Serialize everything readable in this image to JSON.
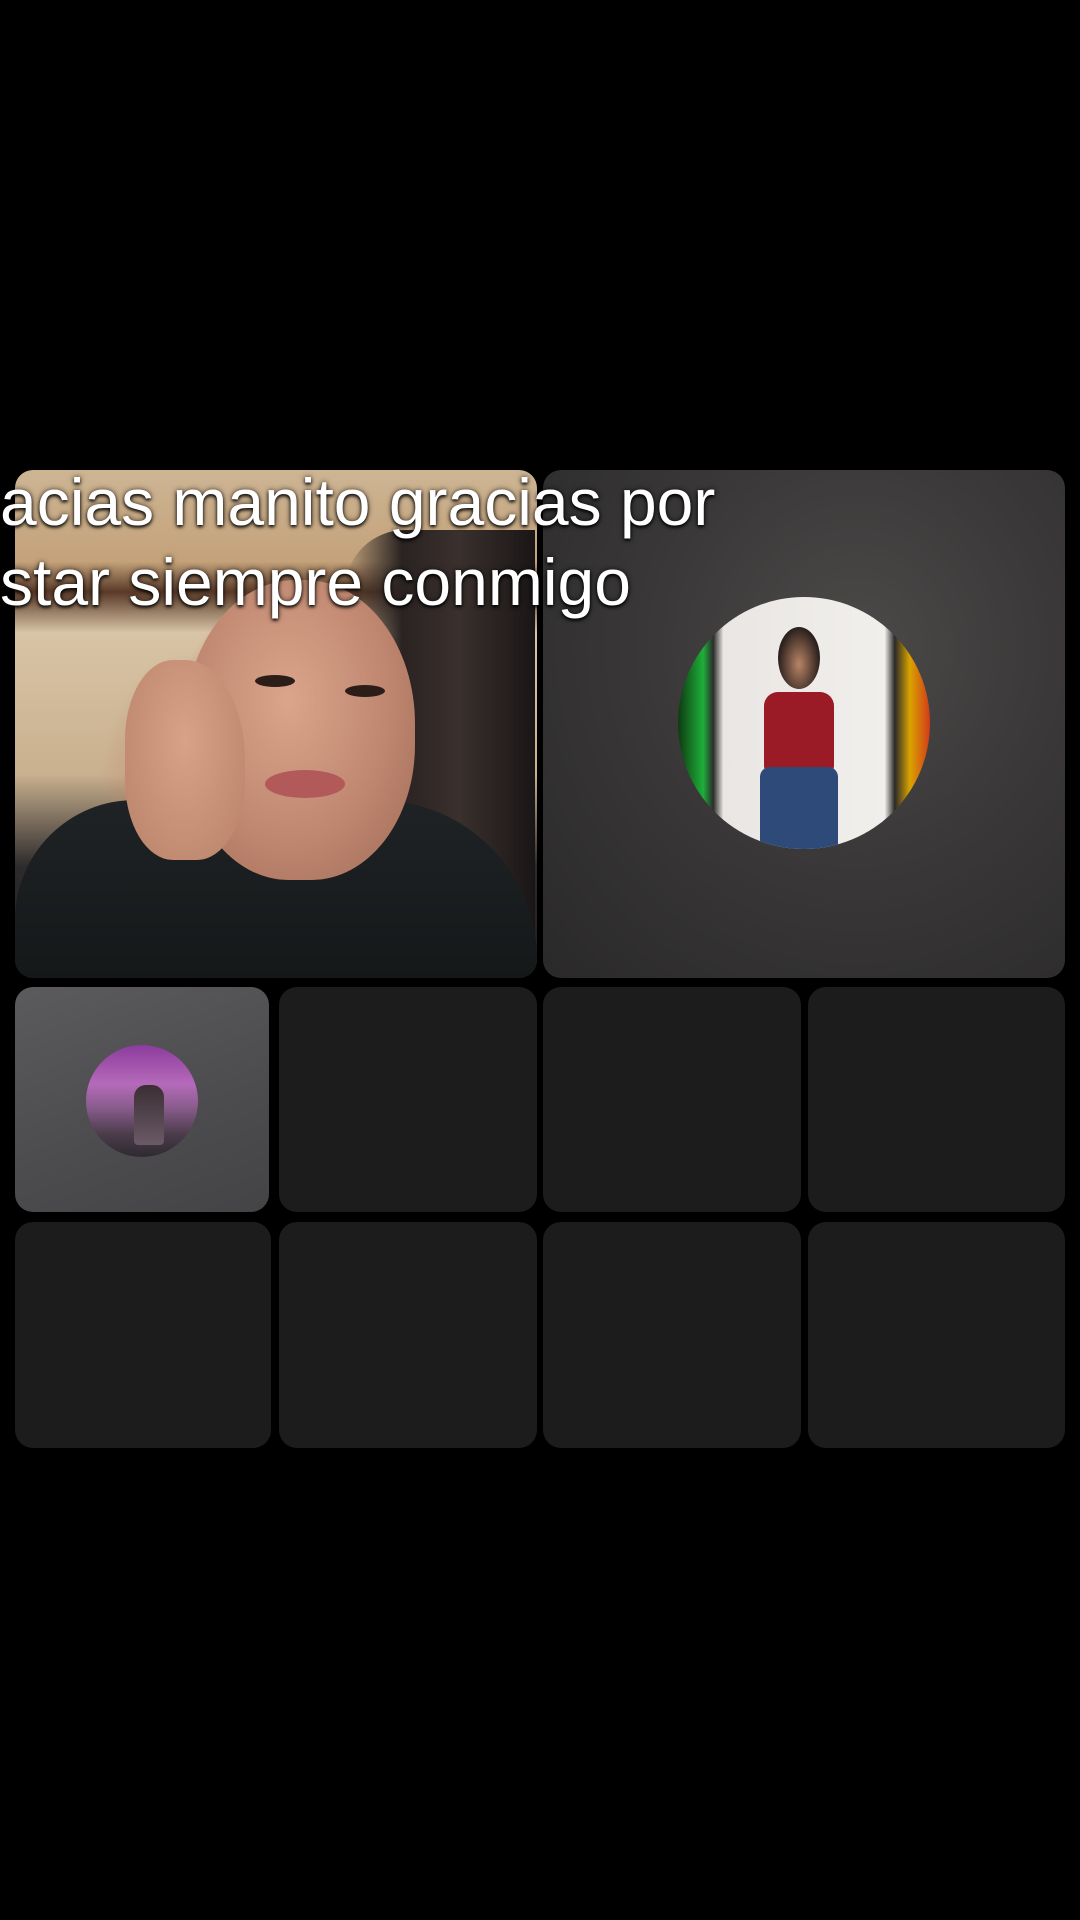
{
  "caption": {
    "line1": "acias manito gracias por",
    "line2": "star siempre conmigo"
  },
  "participants": {
    "host": {
      "kind": "video"
    },
    "guest": {
      "kind": "avatar"
    },
    "small": {
      "kind": "avatar"
    },
    "empty_seats": 7
  },
  "colors": {
    "background": "#000000",
    "tile_empty": "#1c1c1d",
    "tile_guest": "#3a3838",
    "tile_small": "#4c4b4e",
    "caption_text": "#ffffff"
  }
}
